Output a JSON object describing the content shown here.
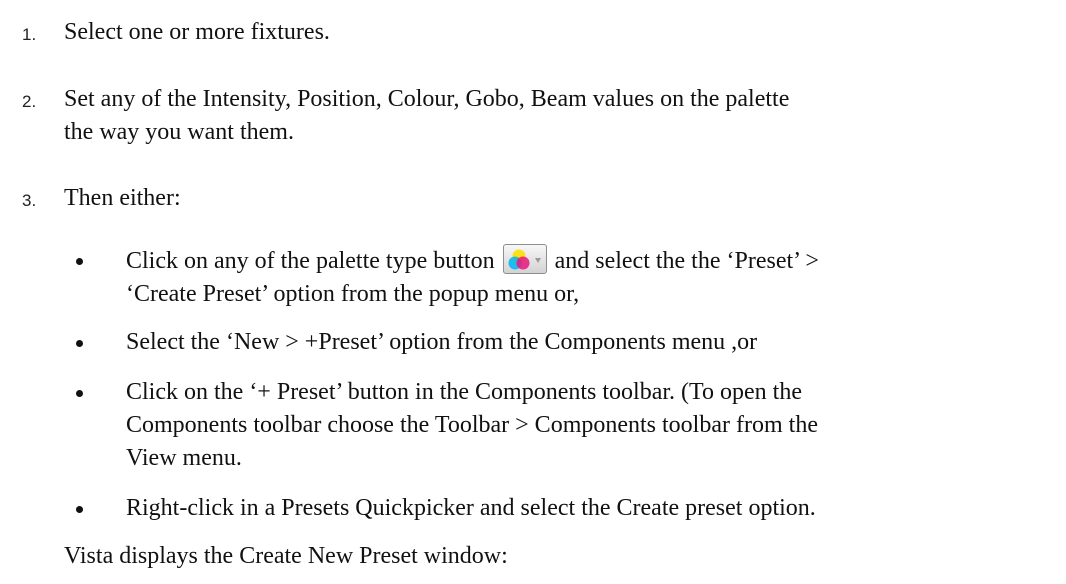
{
  "steps": [
    {
      "number": "1.",
      "text": "Select one or more fixtures."
    },
    {
      "number": "2.",
      "line1": "Set any of the Intensity, Position, Colour, Gobo, Beam values on the palette",
      "line2": "the way you want them."
    },
    {
      "number": "3.",
      "text": "Then either:"
    }
  ],
  "bullets": [
    {
      "line1_before": "Click on any of the palette type button",
      "line1_after": "and select the the ‘Preset’ >",
      "line2": "‘Create Preset’ option from the popup menu or,"
    },
    {
      "text": "Select the ‘New > +Preset’ option from the Components menu ,or"
    },
    {
      "line1": "Click on the ‘+ Preset’ button in the Components toolbar. (To open the",
      "line2": "Components toolbar choose the Toolbar > Components toolbar from the",
      "line3": "View menu."
    },
    {
      "text": "Right-click in a Presets Quickpicker and select the Create preset option."
    }
  ],
  "closing": "Vista displays the Create New Preset window:",
  "icons": {
    "palette_button": "colour-palette-icon",
    "dropdown": "chevron-down-icon"
  },
  "colors": {
    "cyan": "#00b4f0",
    "magenta": "#e8157d",
    "yellow": "#ffe000"
  }
}
